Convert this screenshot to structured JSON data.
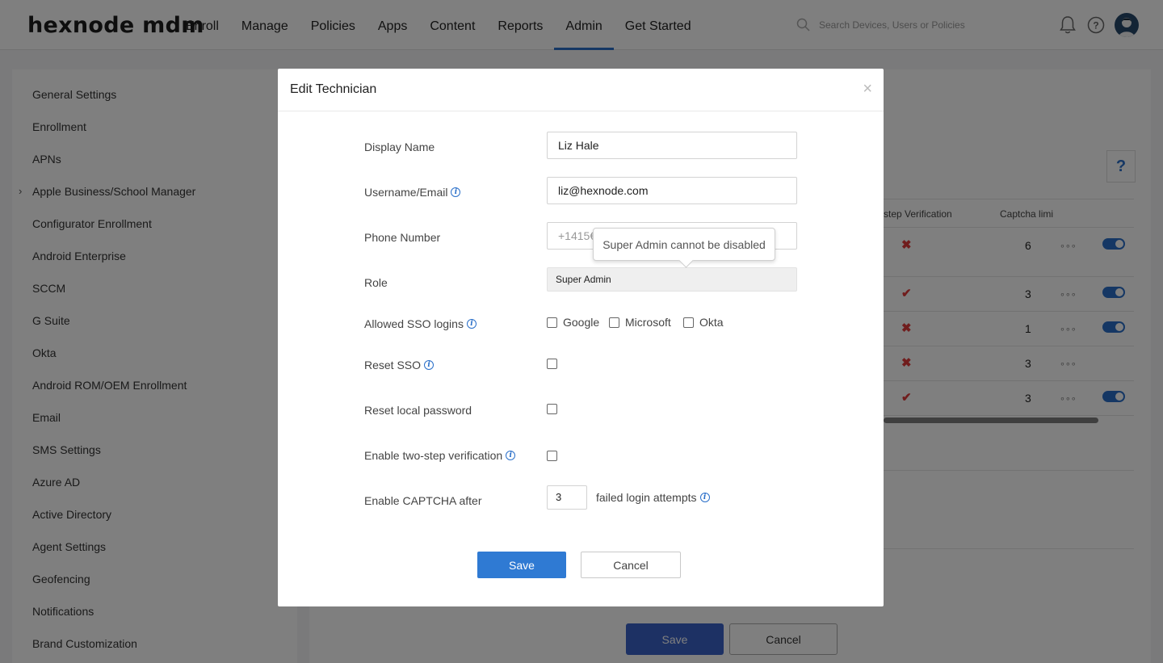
{
  "header": {
    "logo": "hexnode mdm",
    "nav": [
      "Enroll",
      "Manage",
      "Policies",
      "Apps",
      "Content",
      "Reports",
      "Admin",
      "Get Started"
    ],
    "active_nav": "Admin",
    "search_placeholder": "Search Devices, Users or Policies",
    "icons": [
      "bell-icon",
      "help-icon",
      "avatar"
    ]
  },
  "sidebar": {
    "items": [
      "General Settings",
      "Enrollment",
      "APNs",
      "Apple Business/School Manager",
      "Configurator Enrollment",
      "Android Enterprise",
      "SCCM",
      "G Suite",
      "Okta",
      "Android ROM/OEM Enrollment",
      "Email",
      "SMS Settings",
      "Azure AD",
      "Active Directory",
      "Agent Settings",
      "Geofencing",
      "Notifications",
      "Brand Customization"
    ]
  },
  "background_table": {
    "help_label": "?",
    "headers": [
      "step Verification",
      "Captcha limi"
    ],
    "rows": [
      {
        "verification": "✖",
        "captcha": "6",
        "more": "∘∘∘",
        "toggle": true
      },
      {
        "verification": "✔",
        "captcha": "3",
        "more": "∘∘∘",
        "toggle": true
      },
      {
        "verification": "✖",
        "captcha": "1",
        "more": "∘∘∘",
        "toggle": true
      },
      {
        "verification": "✖",
        "captcha": "3",
        "more": "∘∘∘",
        "toggle": false
      },
      {
        "verification": "✔",
        "captcha": "3",
        "more": "∘∘∘",
        "toggle": true
      }
    ],
    "save_label": "Save",
    "cancel_label": "Cancel"
  },
  "modal": {
    "title": "Edit Technician",
    "close": "×",
    "display_name_label": "Display Name",
    "display_name_value": "Liz Hale",
    "username_label": "Username/Email",
    "username_value": "liz@hexnode.com",
    "phone_label": "Phone Number",
    "phone_value": "+1415€",
    "role_label": "Role",
    "role_value": "Super Admin",
    "tooltip": "Super Admin cannot be disabled",
    "sso_label": "Allowed SSO logins",
    "sso_options": [
      "Google",
      "Microsoft",
      "Okta"
    ],
    "reset_sso_label": "Reset SSO",
    "reset_password_label": "Reset local password",
    "two_step_label": "Enable two-step verification",
    "captcha_label": "Enable CAPTCHA after",
    "captcha_value": "3",
    "captcha_suffix": "failed login attempts",
    "save_label": "Save",
    "cancel_label": "Cancel"
  }
}
